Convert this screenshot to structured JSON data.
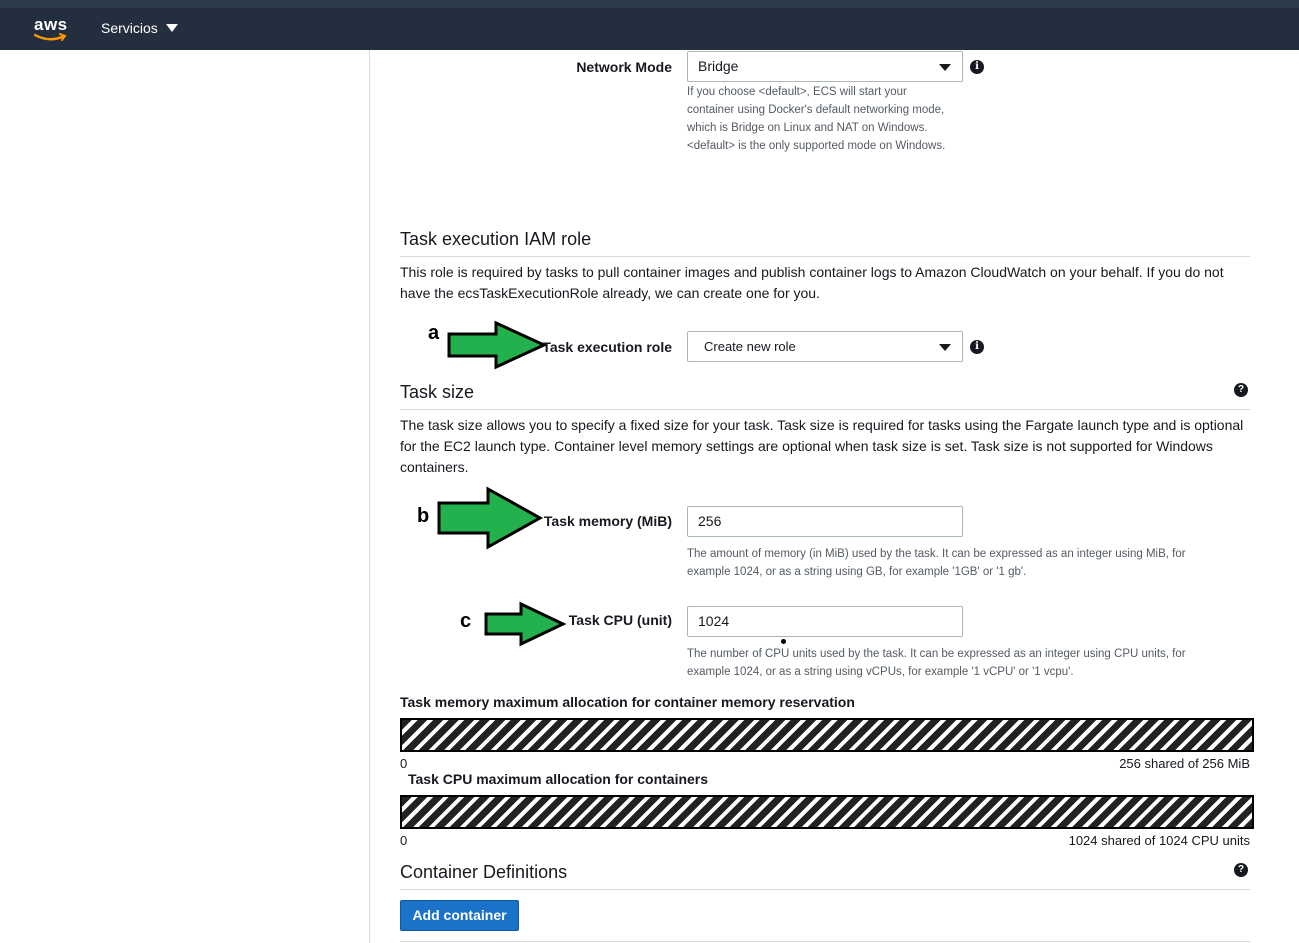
{
  "topbar": {
    "logo_text": "aws",
    "services_label": "Servicios"
  },
  "network_mode": {
    "label": "Network Mode",
    "value": "Bridge",
    "hint": "If you choose <default>, ECS will start your container using Docker's default networking mode, which is Bridge on Linux and NAT on Windows. <default> is the only supported mode on Windows.",
    "hint_lines": [
      "If you choose <default>, ECS will start your",
      "container using Docker's default networking mode,",
      "which is Bridge on Linux and NAT on Windows.",
      "<default> is the only supported mode on Windows."
    ]
  },
  "execution_role_section": {
    "title": "Task execution IAM role",
    "description_lines": [
      "This role is required by tasks to pull container images and publish container logs to Amazon CloudWatch on your behalf. If you do not",
      "have the ecsTaskExecutionRole already, we can create one for you."
    ],
    "role_label": "Task execution role",
    "role_value": "Create new role"
  },
  "task_size_section": {
    "title": "Task size",
    "description_lines": [
      "The task size allows you to specify a fixed size for your task. Task size is required for tasks using the Fargate launch type and is optional",
      "for the EC2 launch type. Container level memory settings are optional when task size is set. Task size is not supported for Windows",
      "containers."
    ],
    "memory_label": "Task memory (MiB)",
    "memory_value": "256",
    "memory_hint_lines": [
      "The amount of memory (in MiB) used by the task. It can be expressed as an integer using MiB, for",
      "example 1024, or as a string using GB, for example '1GB' or '1 gb'."
    ],
    "cpu_label": "Task CPU (unit)",
    "cpu_value": "1024",
    "cpu_hint_lines": [
      "The number of CPU units used by the task. It can be expressed as an integer using CPU units, for",
      "example 1024, or as a string using vCPUs, for example '1 vCPU' or '1 vcpu'."
    ]
  },
  "annotations": {
    "a": "a",
    "b": "b",
    "c": "c",
    "arrow_color": "#22b14c"
  },
  "memory_allocation": {
    "title": "Task memory maximum allocation for container memory reservation",
    "min": "0",
    "max_label": "256 shared of 256 MiB",
    "fraction": 1.0
  },
  "cpu_allocation": {
    "title": "Task CPU maximum allocation for containers",
    "min": "0",
    "max_label": "1024 shared of 1024 CPU units",
    "fraction": 1.0
  },
  "container_definitions": {
    "title": "Container Definitions",
    "add_button": "Add container"
  },
  "colors": {
    "topbar": "#232f3e",
    "primary_button": "#1a73c9",
    "logo_smile": "#ff9900"
  }
}
